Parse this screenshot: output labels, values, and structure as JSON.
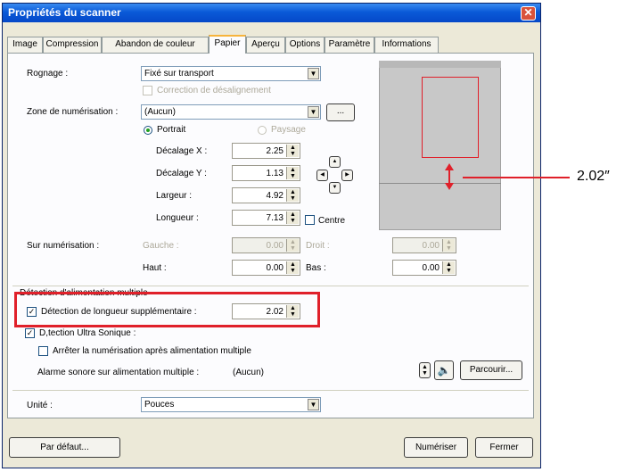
{
  "window": {
    "title": "Propriétés du scanner",
    "close": "✕"
  },
  "tabs": [
    "Image",
    "Compression",
    "Abandon de couleur",
    "Papier",
    "Aperçu",
    "Options",
    "Paramètre",
    "Informations"
  ],
  "active_tab": "Papier",
  "cropping": {
    "label": "Rognage :",
    "value": "Fixé sur transport"
  },
  "deskew": {
    "label": "Correction de désalignement"
  },
  "scan_area": {
    "label": "Zone de numérisation :",
    "value": "(Aucun)",
    "browse": "..."
  },
  "orientation": {
    "portrait": "Portrait",
    "landscape": "Paysage"
  },
  "offset_x": {
    "label": "Décalage X :",
    "value": "2.25"
  },
  "offset_y": {
    "label": "Décalage Y :",
    "value": "1.13"
  },
  "width": {
    "label": "Largeur :",
    "value": "4.92"
  },
  "length": {
    "label": "Longueur :",
    "value": "7.13"
  },
  "center": {
    "label": "Centre"
  },
  "overscan": {
    "label": "Sur numérisation :",
    "left": {
      "label": "Gauche :",
      "value": "0.00"
    },
    "right": {
      "label": "Droit :",
      "value": "0.00"
    },
    "top": {
      "label": "Haut :",
      "value": "0.00"
    },
    "bottom": {
      "label": "Bas :",
      "value": "0.00"
    }
  },
  "multifeed": {
    "group_label": "Détection d'alimentation multiple",
    "length_check": {
      "label": "Détection de longueur supplémentaire :",
      "value": "2.02"
    },
    "ultrasonic": {
      "label": "D,tection Ultra Sonique :"
    },
    "stop": {
      "label": "Arrêter la numérisation après alimentation multiple"
    },
    "alarm": {
      "label": "Alarme sonore sur alimentation multiple :",
      "value": "(Aucun)",
      "browse": "Parcourir..."
    }
  },
  "unit": {
    "label": "Unité :",
    "value": "Pouces"
  },
  "buttons": {
    "default": "Par défaut...",
    "scan": "Numériser",
    "close": "Fermer"
  },
  "callout": {
    "value": "2.02″"
  },
  "colors": {
    "highlight": "#e0202a",
    "preview_bg": "#c8c8c8",
    "title_bar": "#0a5ad8"
  }
}
